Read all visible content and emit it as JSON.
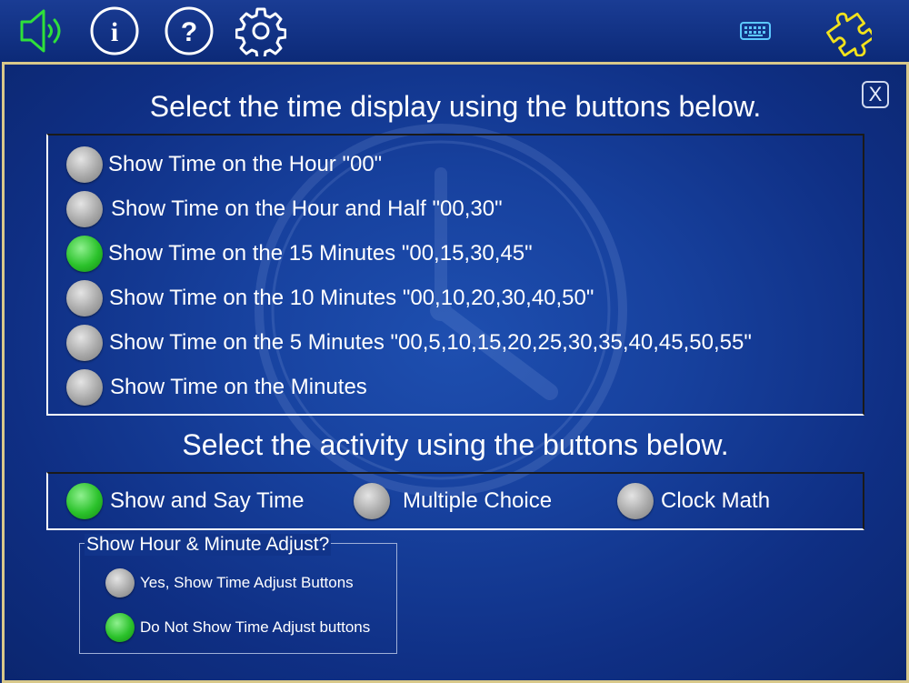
{
  "toolbar": {
    "items": [
      {
        "name": "speaker-icon",
        "color": "#2fe03a"
      },
      {
        "name": "info-icon",
        "glyph": "i"
      },
      {
        "name": "help-icon",
        "glyph": "?"
      },
      {
        "name": "gear-icon"
      },
      {
        "name": "keyboard-icon"
      },
      {
        "name": "puzzle-icon",
        "color": "#f2e21c"
      }
    ]
  },
  "dialog": {
    "close_label": "X",
    "time_heading": "Select the time display using the buttons below.",
    "time_options": [
      {
        "label": "Show Time on the Hour \"00\"",
        "selected": false
      },
      {
        "label": "Show Time on the Hour and Half \"00,30\"",
        "selected": false
      },
      {
        "label": "Show Time on the 15 Minutes \"00,15,30,45\"",
        "selected": true
      },
      {
        "label": "Show Time on the 10 Minutes \"00,10,20,30,40,50\"",
        "selected": false
      },
      {
        "label": "Show Time on the 5 Minutes \"00,5,10,15,20,25,30,35,40,45,50,55\"",
        "selected": false
      },
      {
        "label": "Show Time on the Minutes",
        "selected": false
      }
    ],
    "activity_heading": "Select the activity using the buttons below.",
    "activities": [
      {
        "label": "Show and Say Time",
        "selected": true
      },
      {
        "label": "Multiple Choice",
        "selected": false
      },
      {
        "label": "Clock Math",
        "selected": false
      }
    ],
    "adjust": {
      "title": "Show Hour & Minute Adjust?",
      "options": [
        {
          "label": "Yes, Show Time Adjust Buttons",
          "selected": false
        },
        {
          "label": "Do Not Show Time Adjust buttons",
          "selected": true
        }
      ]
    }
  },
  "colors": {
    "selected": "#2bc22b",
    "unselected": "#a8a8a8",
    "panel_border": "#d8c88a",
    "background": "#17419e"
  }
}
